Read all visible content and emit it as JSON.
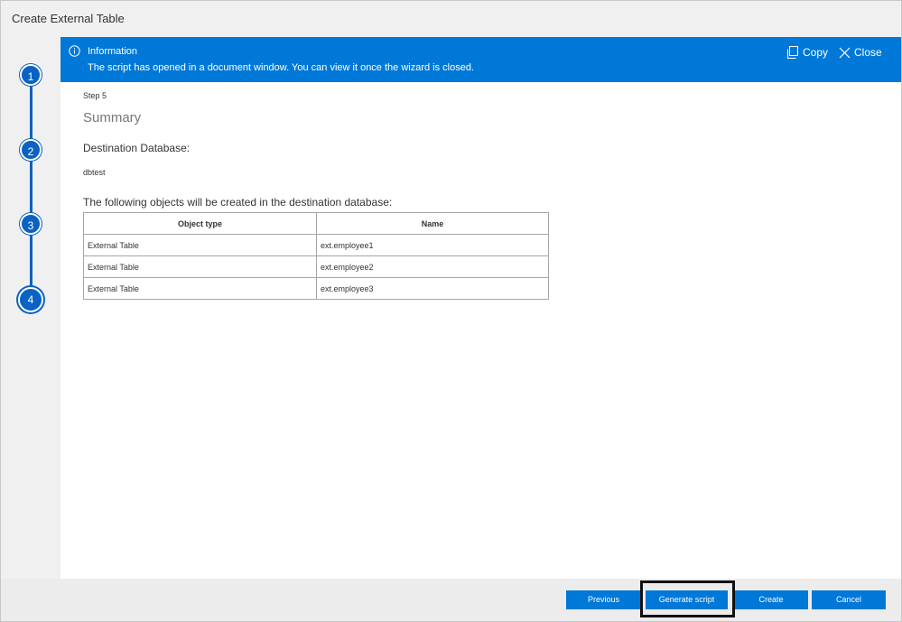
{
  "window": {
    "title": "Create External Table"
  },
  "steps": [
    "1",
    "2",
    "3",
    "4"
  ],
  "banner": {
    "title": "Information",
    "message": "The script has opened in a document window. You can view it once the wizard is closed.",
    "copy_label": "Copy",
    "close_label": "Close"
  },
  "page": {
    "step_label": "Step 5",
    "heading": "Summary",
    "destination_label": "Destination Database:",
    "destination_value": "dbtest",
    "objects_label": "The following objects will be created in the destination database:"
  },
  "table": {
    "headers": [
      "Object type",
      "Name"
    ],
    "rows": [
      [
        "External Table",
        "ext.employee1"
      ],
      [
        "External Table",
        "ext.employee2"
      ],
      [
        "External Table",
        "ext.employee3"
      ]
    ]
  },
  "footer": {
    "previous_label": "Previous",
    "generate_label": "Generate script",
    "create_label": "Create",
    "cancel_label": "Cancel"
  },
  "colors": {
    "accent": "#0078d7",
    "step": "#0a62c2",
    "rail": "#f0f0f0"
  },
  "icons": {
    "banner": "info-icon",
    "copy": "copy-icon",
    "close": "close-icon"
  }
}
